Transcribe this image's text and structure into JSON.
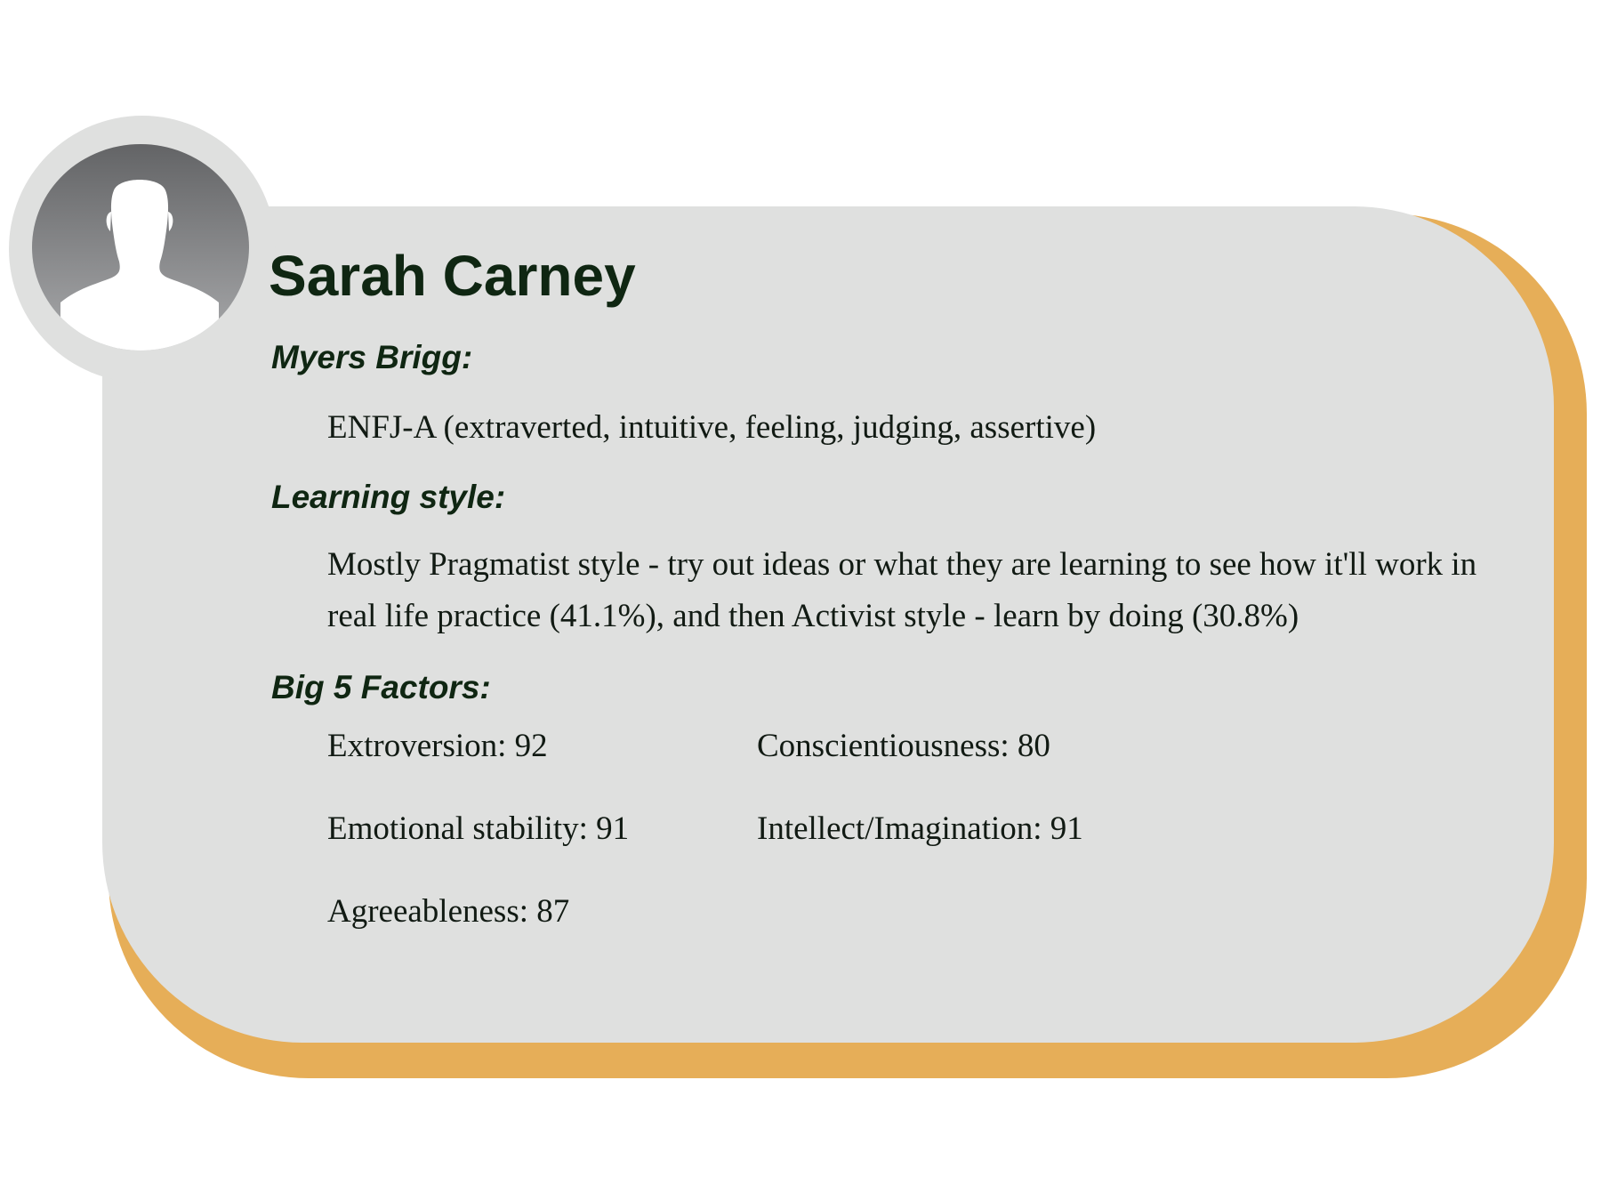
{
  "colors": {
    "card_background": "#dfe0df",
    "card_shadow": "#e6ae58",
    "heading_text": "#0f2612",
    "body_text": "#111a13",
    "avatar_gradient_top": "#636466",
    "avatar_gradient_bottom": "#a9aaac"
  },
  "avatar": {
    "icon": "person-silhouette-icon"
  },
  "profile": {
    "name": "Sarah Carney"
  },
  "myers_brigg": {
    "label": "Myers Brigg:",
    "value": "ENFJ-A (extraverted, intuitive, feeling, judging, assertive)"
  },
  "learning_style": {
    "label": "Learning style:",
    "value": "Mostly Pragmatist style - try out ideas or what they are learning to see how it'll work in real life practice (41.1%), and then Activist style - learn by doing (30.8%)"
  },
  "big5": {
    "label": "Big 5 Factors:",
    "factors": [
      {
        "text": "Extroversion: 92"
      },
      {
        "text": "Conscientiousness: 80"
      },
      {
        "text": "Emotional stability: 91"
      },
      {
        "text": "Intellect/Imagination: 91"
      },
      {
        "text": "Agreeableness: 87"
      }
    ]
  }
}
